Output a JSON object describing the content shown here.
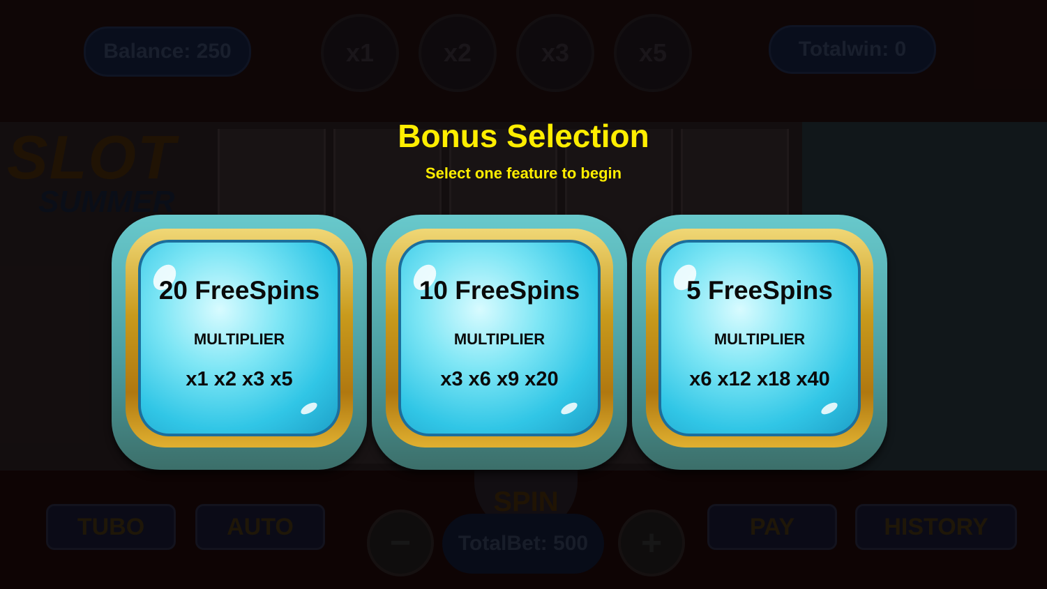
{
  "hud": {
    "balance": "Balance: 250",
    "totalwin": "Totalwin: 0",
    "multipliers": [
      "x1",
      "x2",
      "x3",
      "x5"
    ]
  },
  "background": {
    "logo_line1": "SLOT",
    "logo_line2": "SUMMER"
  },
  "controls": {
    "turbo": "TUBO",
    "auto": "AUTO",
    "spin": "SPIN",
    "minus": "−",
    "plus": "+",
    "totalbet": "TotalBet: 500",
    "pay": "PAY",
    "history": "HISTORY"
  },
  "dialog": {
    "title": "Bonus Selection",
    "subtitle": "Select one feature to begin",
    "options": [
      {
        "spins": "20 FreeSpins",
        "label": "MULTIPLIER",
        "values": "x1 x2 x3 x5"
      },
      {
        "spins": "10 FreeSpins",
        "label": "MULTIPLIER",
        "values": "x3 x6 x9 x20"
      },
      {
        "spins": "5 FreeSpins",
        "label": "MULTIPLIER",
        "values": "x6 x12 x18 x40"
      }
    ]
  },
  "colors": {
    "title": "#ffee00",
    "card_gold": "#c89a1c",
    "card_glass": "#31c6e6"
  }
}
